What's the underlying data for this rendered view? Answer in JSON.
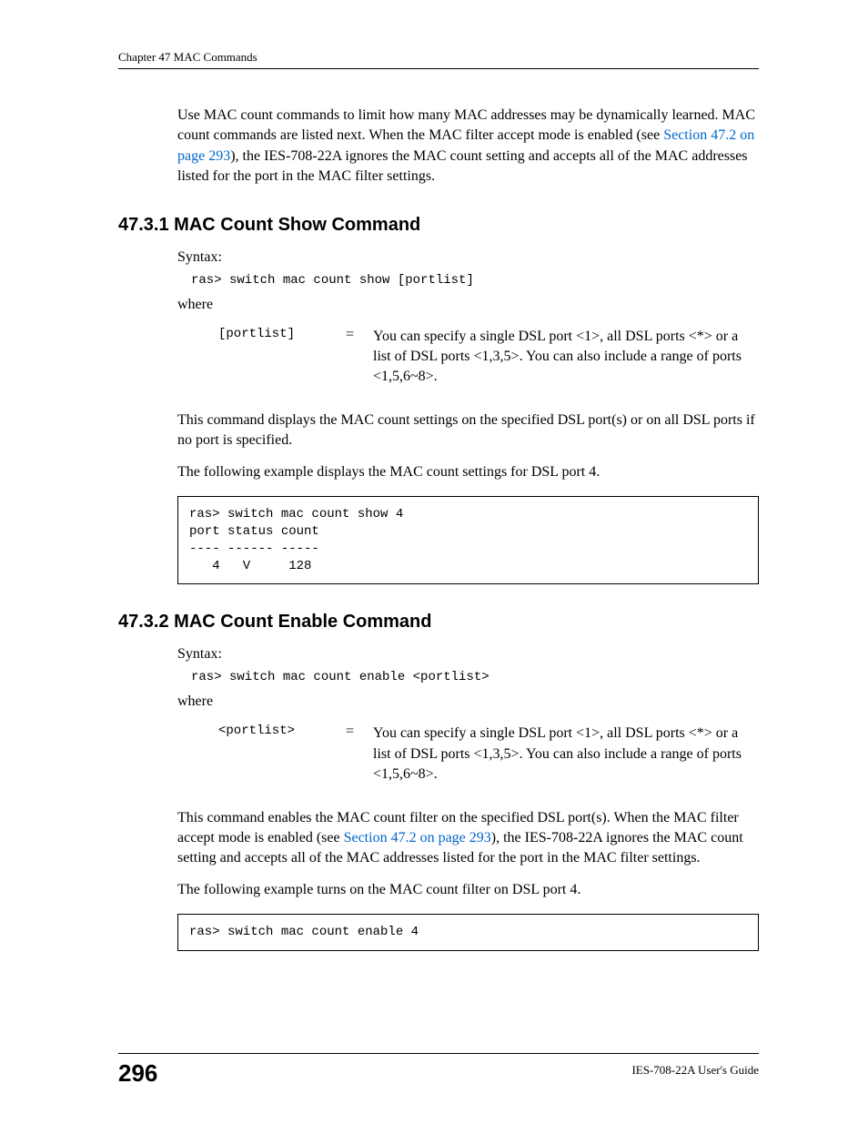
{
  "header": {
    "chapter": "Chapter 47 MAC Commands"
  },
  "intro": {
    "text1": "Use MAC count commands to limit how many MAC addresses may be dynamically learned. MAC count commands are listed next. When the MAC filter accept mode is enabled (see ",
    "link1": "Section 47.2 on page 293",
    "text2": "), the IES-708-22A ignores the MAC count setting and accepts all of the MAC addresses listed for the port in the MAC filter settings."
  },
  "section1": {
    "heading": "47.3.1  MAC Count Show Command",
    "syntax_label": "Syntax:",
    "syntax_code": "ras> switch mac count show [portlist]",
    "where_label": "where",
    "param_name": "[portlist]",
    "param_eq": "=",
    "param_desc": "You can specify a single DSL port <1>, all DSL ports <*> or a list of DSL ports <1,3,5>. You can also include a range of ports <1,5,6~8>.",
    "body1": "This command displays the MAC count settings on the specified DSL port(s) or on all DSL ports if no port is specified.",
    "body2": "The following example displays the MAC count settings for DSL port 4.",
    "code_output": "ras> switch mac count show 4\nport status count\n---- ------ -----\n   4   V     128"
  },
  "section2": {
    "heading": "47.3.2  MAC Count Enable Command",
    "syntax_label": "Syntax:",
    "syntax_code": "ras> switch mac count enable <portlist>",
    "where_label": "where",
    "param_name": "<portlist>",
    "param_eq": "=",
    "param_desc": "You can specify a single DSL port <1>, all DSL ports <*> or a list of DSL ports <1,3,5>. You can also include a range of ports <1,5,6~8>.",
    "body1_a": "This command enables the MAC count filter on the specified DSL port(s). When the MAC filter accept mode is enabled (see ",
    "body1_link": "Section 47.2 on page 293",
    "body1_b": "), the IES-708-22A ignores the MAC count setting and accepts all of the MAC addresses listed for the port in the MAC filter settings.",
    "body2": "The following example turns on the MAC count filter on DSL port 4.",
    "code_output": "ras> switch mac count enable 4"
  },
  "footer": {
    "page": "296",
    "guide": "IES-708-22A User's Guide"
  }
}
